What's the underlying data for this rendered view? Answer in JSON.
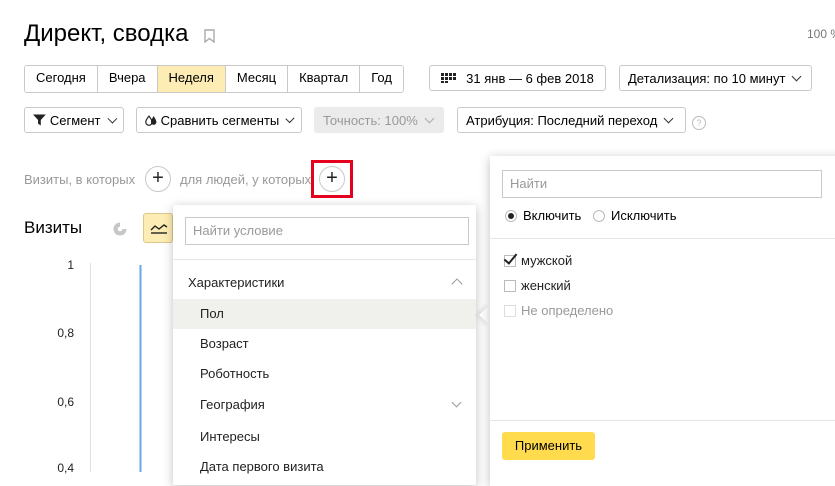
{
  "header": {
    "title": "Директ, сводка",
    "zoom": "100 %"
  },
  "period_tabs": [
    {
      "label": "Сегодня",
      "active": false
    },
    {
      "label": "Вчера",
      "active": false
    },
    {
      "label": "Неделя",
      "active": true
    },
    {
      "label": "Месяц",
      "active": false
    },
    {
      "label": "Квартал",
      "active": false
    },
    {
      "label": "Год",
      "active": false
    }
  ],
  "date_range": {
    "label": "31 янв — 6 фев 2018"
  },
  "detail": {
    "label": "Детализация: по 10 минут"
  },
  "toolbar": {
    "segment_label": "Сегмент",
    "compare_label": "Сравнить сегменты",
    "accuracy_label": "Точность: 100%",
    "attribution_label": "Атрибуция: Последний переход",
    "help": "?"
  },
  "filter": {
    "visits_label": "Визиты, в которых",
    "people_label": "для людей, у которых",
    "plus": "+"
  },
  "chart_section": {
    "title": "Визиты"
  },
  "chart_data": {
    "type": "line",
    "title": "",
    "xlabel": "",
    "ylabel": "",
    "y_ticks": [
      "1",
      "0,8",
      "0,6",
      "0,4"
    ],
    "ylim": [
      0.4,
      1
    ],
    "series": [
      {
        "color": "#6aa7e4"
      }
    ]
  },
  "condition_dropdown": {
    "search_placeholder": "Найти условие",
    "category": "Характеристики",
    "items": [
      {
        "label": "Пол",
        "selected": true,
        "expandable": false
      },
      {
        "label": "Возраст",
        "selected": false,
        "expandable": false
      },
      {
        "label": "Роботность",
        "selected": false,
        "expandable": false
      },
      {
        "label": "География",
        "selected": false,
        "expandable": true
      },
      {
        "label": "Интересы",
        "selected": false,
        "expandable": false
      },
      {
        "label": "Дата первого визита",
        "selected": false,
        "expandable": false
      }
    ]
  },
  "value_dropdown": {
    "search_placeholder": "Найти",
    "include_label": "Включить",
    "exclude_label": "Исключить",
    "options": [
      {
        "label": "мужской",
        "checked": true,
        "disabled": false
      },
      {
        "label": "женский",
        "checked": false,
        "disabled": false
      },
      {
        "label": "Не определено",
        "checked": false,
        "disabled": true
      }
    ],
    "apply_label": "Применить"
  },
  "colors": {
    "accent_yellow": "#ffdb4d",
    "active_tab": "#fdedb5",
    "highlight_red": "#e5001e",
    "series_blue": "#6aa7e4"
  }
}
